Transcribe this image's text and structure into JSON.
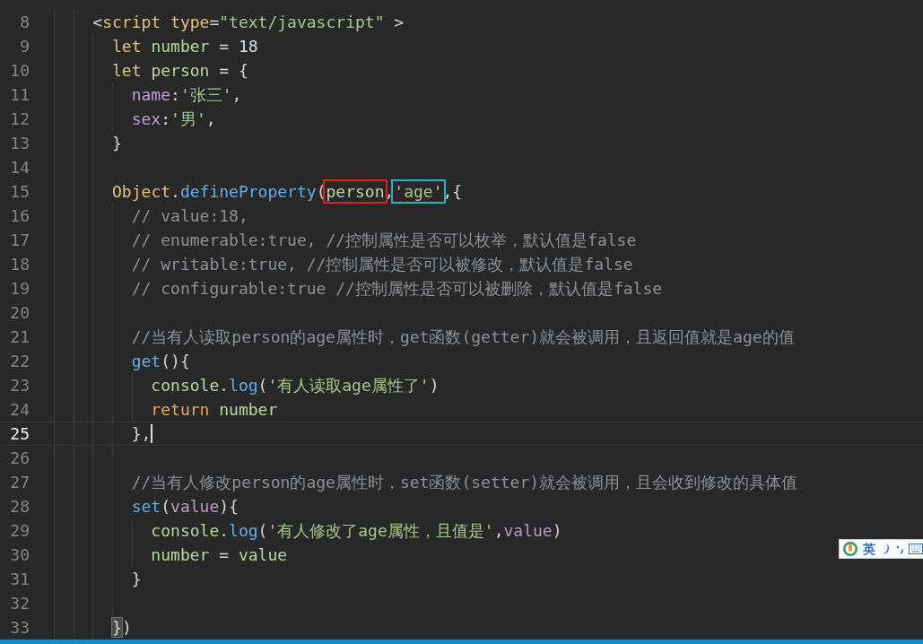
{
  "editor": {
    "lines": [
      {
        "number": "8",
        "current": false,
        "cursor": false,
        "tokens": [
          {
            "text": "    <",
            "kind": "punct"
          },
          {
            "text": "script",
            "kind": "tag"
          },
          {
            "text": " type",
            "kind": "attr"
          },
          {
            "text": "=",
            "kind": "punct"
          },
          {
            "text": "\"text/javascript\"",
            "kind": "string"
          },
          {
            "text": " >",
            "kind": "punct"
          }
        ]
      },
      {
        "number": "9",
        "current": false,
        "cursor": false,
        "tokens": [
          {
            "text": "      let",
            "kind": "keyword"
          },
          {
            "text": " number",
            "kind": "variable"
          },
          {
            "text": " = ",
            "kind": "punct"
          },
          {
            "text": "18",
            "kind": "number"
          }
        ]
      },
      {
        "number": "10",
        "current": false,
        "cursor": false,
        "tokens": [
          {
            "text": "      let",
            "kind": "keyword"
          },
          {
            "text": " person",
            "kind": "variable"
          },
          {
            "text": " = {",
            "kind": "punct"
          }
        ]
      },
      {
        "number": "11",
        "current": false,
        "cursor": false,
        "tokens": [
          {
            "text": "        name",
            "kind": "prop"
          },
          {
            "text": ":",
            "kind": "punct"
          },
          {
            "text": "'张三'",
            "kind": "string"
          },
          {
            "text": ",",
            "kind": "punct"
          }
        ]
      },
      {
        "number": "12",
        "current": false,
        "cursor": false,
        "tokens": [
          {
            "text": "        sex",
            "kind": "prop"
          },
          {
            "text": ":",
            "kind": "punct"
          },
          {
            "text": "'男'",
            "kind": "string"
          },
          {
            "text": ",",
            "kind": "punct"
          }
        ]
      },
      {
        "number": "13",
        "current": false,
        "cursor": false,
        "tokens": [
          {
            "text": "      }",
            "kind": "punct"
          }
        ]
      },
      {
        "number": "14",
        "current": false,
        "cursor": false
      },
      {
        "number": "15",
        "current": false,
        "cursor": false,
        "tokens": [
          {
            "text": "      Object",
            "kind": "keyword"
          },
          {
            "text": ".",
            "kind": "punct"
          },
          {
            "text": "defineProperty",
            "kind": "func"
          },
          {
            "text": "(",
            "kind": "punct"
          },
          {
            "text": "person",
            "kind": "variable",
            "color": "#e0201c"
          },
          {
            "text": ",",
            "kind": "punct"
          },
          {
            "text": "'age'",
            "kind": "string",
            "color": "#27b3c2"
          },
          {
            "text": ",{",
            "kind": "punct"
          }
        ]
      },
      {
        "number": "16",
        "current": false,
        "cursor": false,
        "tokens": [
          {
            "text": "        // value:18,",
            "kind": "comment"
          }
        ]
      },
      {
        "number": "17",
        "current": false,
        "cursor": false,
        "tokens": [
          {
            "text": "        // enumerable:true, //控制属性是否可以枚举，默认值是false",
            "kind": "comment"
          }
        ]
      },
      {
        "number": "18",
        "current": false,
        "cursor": false,
        "tokens": [
          {
            "text": "        // writable:true, //控制属性是否可以被修改，默认值是false",
            "kind": "comment"
          }
        ]
      },
      {
        "number": "19",
        "current": false,
        "cursor": false,
        "tokens": [
          {
            "text": "        // configurable:true //控制属性是否可以被删除，默认值是false",
            "kind": "comment"
          }
        ]
      },
      {
        "number": "20",
        "current": false,
        "cursor": false
      },
      {
        "number": "21",
        "current": false,
        "cursor": false,
        "tokens": [
          {
            "text": "        //当有人读取person的age属性时，get函数(getter)就会被调用，且返回值就是age的值",
            "kind": "comment"
          }
        ]
      },
      {
        "number": "22",
        "current": false,
        "cursor": false,
        "tokens": [
          {
            "text": "        get",
            "kind": "func"
          },
          {
            "text": "(){",
            "kind": "punct"
          }
        ]
      },
      {
        "number": "23",
        "current": false,
        "cursor": false,
        "tokens": [
          {
            "text": "          console.",
            "kind": "variable"
          },
          {
            "text": "log",
            "kind": "func"
          },
          {
            "text": "(",
            "kind": "punct"
          },
          {
            "text": "'有人读取age属性了'",
            "kind": "string"
          },
          {
            "text": ")",
            "kind": "punct"
          }
        ]
      },
      {
        "number": "24",
        "current": false,
        "cursor": false,
        "tokens": [
          {
            "text": "          return",
            "kind": "control"
          },
          {
            "text": " number",
            "kind": "variable"
          }
        ]
      },
      {
        "number": "25",
        "current": true,
        "cursor": true,
        "tokens": [
          {
            "text": "        },",
            "kind": "punct"
          }
        ]
      },
      {
        "number": "26",
        "current": false,
        "cursor": false
      },
      {
        "number": "27",
        "current": false,
        "cursor": false,
        "tokens": [
          {
            "text": "        //当有人修改person的age属性时，set函数(setter)就会被调用，且会收到修改的具体值",
            "kind": "comment"
          }
        ]
      },
      {
        "number": "28",
        "current": false,
        "cursor": false,
        "tokens": [
          {
            "text": "        set",
            "kind": "func"
          },
          {
            "text": "(",
            "kind": "punct"
          },
          {
            "text": "value",
            "kind": "param"
          },
          {
            "text": "){",
            "kind": "punct"
          }
        ]
      },
      {
        "number": "29",
        "current": false,
        "cursor": false,
        "tokens": [
          {
            "text": "          console.",
            "kind": "variable"
          },
          {
            "text": "log",
            "kind": "func"
          },
          {
            "text": "(",
            "kind": "punct"
          },
          {
            "text": "'有人修改了age属性，且值是'",
            "kind": "string"
          },
          {
            "text": ",",
            "kind": "punct"
          },
          {
            "text": "value",
            "kind": "param"
          },
          {
            "text": ")",
            "kind": "punct"
          }
        ]
      },
      {
        "number": "30",
        "current": false,
        "cursor": false,
        "tokens": [
          {
            "text": "          number",
            "kind": "variable"
          },
          {
            "text": " = ",
            "kind": "punct"
          },
          {
            "text": "value",
            "kind": "variable"
          }
        ]
      },
      {
        "number": "31",
        "current": false,
        "cursor": false,
        "tokens": [
          {
            "text": "        }",
            "kind": "punct"
          }
        ]
      },
      {
        "number": "32",
        "current": false,
        "cursor": false
      },
      {
        "number": "33",
        "current": false,
        "cursor": false,
        "tokens": [
          {
            "text": "      }",
            "kind": "punct",
            "matched": true
          },
          {
            "text": ")",
            "kind": "punct"
          }
        ]
      }
    ]
  },
  "ime_toolbar": {
    "mode": "英"
  }
}
